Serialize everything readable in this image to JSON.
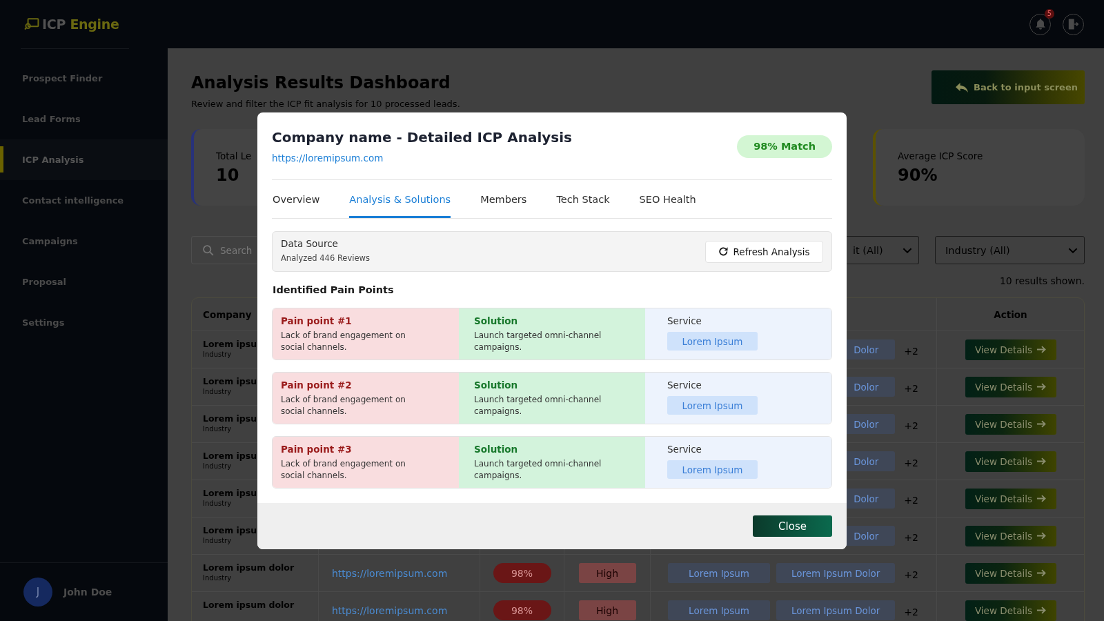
{
  "sidebar": {
    "logo": {
      "name": "ICP",
      "accent": "Engine"
    },
    "items": [
      {
        "label": "Prospect Finder",
        "selected": false
      },
      {
        "label": "Lead Forms",
        "selected": false
      },
      {
        "label": "ICP Analysis",
        "selected": true
      },
      {
        "label": "Contact intelligence",
        "selected": false
      },
      {
        "label": "Campaigns",
        "selected": false
      },
      {
        "label": "Proposal",
        "selected": false
      },
      {
        "label": "Settings",
        "selected": false
      }
    ],
    "user": {
      "initial": "J",
      "name": "John Doe"
    }
  },
  "top_bar": {
    "notification_count": "5"
  },
  "page": {
    "title": "Analysis Results Dashboard",
    "subtitle": "Review and filter the ICP fit analysis for 10 processed leads.",
    "back_button": "Back to input screen"
  },
  "stats": [
    {
      "label": "Total Le",
      "value": "10",
      "color": "#28327a"
    },
    {
      "label": "Average ICP Score",
      "value": "90%",
      "color": "#5c5200"
    }
  ],
  "filters": {
    "search": {
      "placeholder": "Search"
    },
    "dropdowns": [
      {
        "value": "it (All)"
      },
      {
        "value": "Industry (All)"
      }
    ],
    "results": "10 results shown."
  },
  "table": {
    "header": {
      "company": "Company",
      "action": "Action"
    },
    "rows": [
      {
        "kind": "covered",
        "company": "Lorem ipsu",
        "industry": "Industry",
        "tags": [
          "Dolor"
        ],
        "more": "+2",
        "action": "View Details"
      },
      {
        "kind": "covered",
        "company": "Lorem ipsu",
        "industry": "Industry",
        "tags": [
          "Dolor"
        ],
        "more": "+2",
        "action": "View Details"
      },
      {
        "kind": "covered",
        "company": "Lorem ipsu",
        "industry": "Industry",
        "tags": [
          "Dolor"
        ],
        "more": "+2",
        "action": "View Details"
      },
      {
        "kind": "covered",
        "company": "Lorem ipsu",
        "industry": "Industry",
        "tags": [
          "Dolor"
        ],
        "more": "+2",
        "action": "View Details"
      },
      {
        "kind": "covered",
        "company": "Lorem ipsu",
        "industry": "Industry",
        "tags": [
          "Dolor"
        ],
        "more": "+2",
        "action": "View Details"
      },
      {
        "kind": "covered",
        "company": "Lorem ipsu",
        "industry": "Industry",
        "tags": [
          "Dolor"
        ],
        "more": "+2",
        "action": "View Details"
      },
      {
        "kind": "full",
        "company": "Lorem ipsum dolor",
        "industry": "Industry",
        "url": "https://loremipsum.com",
        "score": "98%",
        "fit": "High",
        "tags": [
          "Lorem Ipsum",
          "Lorem Ipsum Dolor"
        ],
        "more": "+2",
        "action": "View Details"
      },
      {
        "kind": "full",
        "company": "Lorem ipsum dolor",
        "url": "https://loremipsum.com",
        "score": "98%",
        "fit": "High",
        "tags": [
          "Lorem Ipsum",
          "Lorem Ipsum Dolor"
        ],
        "more": "+2",
        "action": "View Details"
      }
    ]
  },
  "modal": {
    "title": "Company name - Detailed ICP Analysis",
    "url": "https://loremipsum.com",
    "match": "98% Match",
    "tabs": [
      {
        "label": "Overview",
        "selected": false
      },
      {
        "label": "Analysis & Solutions",
        "selected": true
      },
      {
        "label": "Members",
        "selected": false
      },
      {
        "label": "Tech Stack",
        "selected": false
      },
      {
        "label": "SEO Health",
        "selected": false
      }
    ],
    "data_source": {
      "label": "Data Source",
      "detail": "Analyzed 446 Reviews",
      "button": "Refresh Analysis"
    },
    "section_title": "Identified Pain Points",
    "pain_points": [
      {
        "title": "Pain point #1",
        "description": "Lack of brand engagement on social channels.",
        "solution_label": "Solution",
        "solution": "Launch targeted omni-channel campaigns.",
        "service_label": "Service",
        "service": "Lorem Ipsum"
      },
      {
        "title": "Pain point #2",
        "description": "Lack of brand engagement on social channels.",
        "solution_label": "Solution",
        "solution": "Launch targeted omni-channel campaigns.",
        "service_label": "Service",
        "service": "Lorem Ipsum"
      },
      {
        "title": "Pain point #3",
        "description": "Lack of brand engagement on social channels.",
        "solution_label": "Solution",
        "solution": "Launch targeted omni-channel campaigns.",
        "service_label": "Service",
        "service": "Lorem Ipsum"
      }
    ],
    "close_button": "Close"
  }
}
